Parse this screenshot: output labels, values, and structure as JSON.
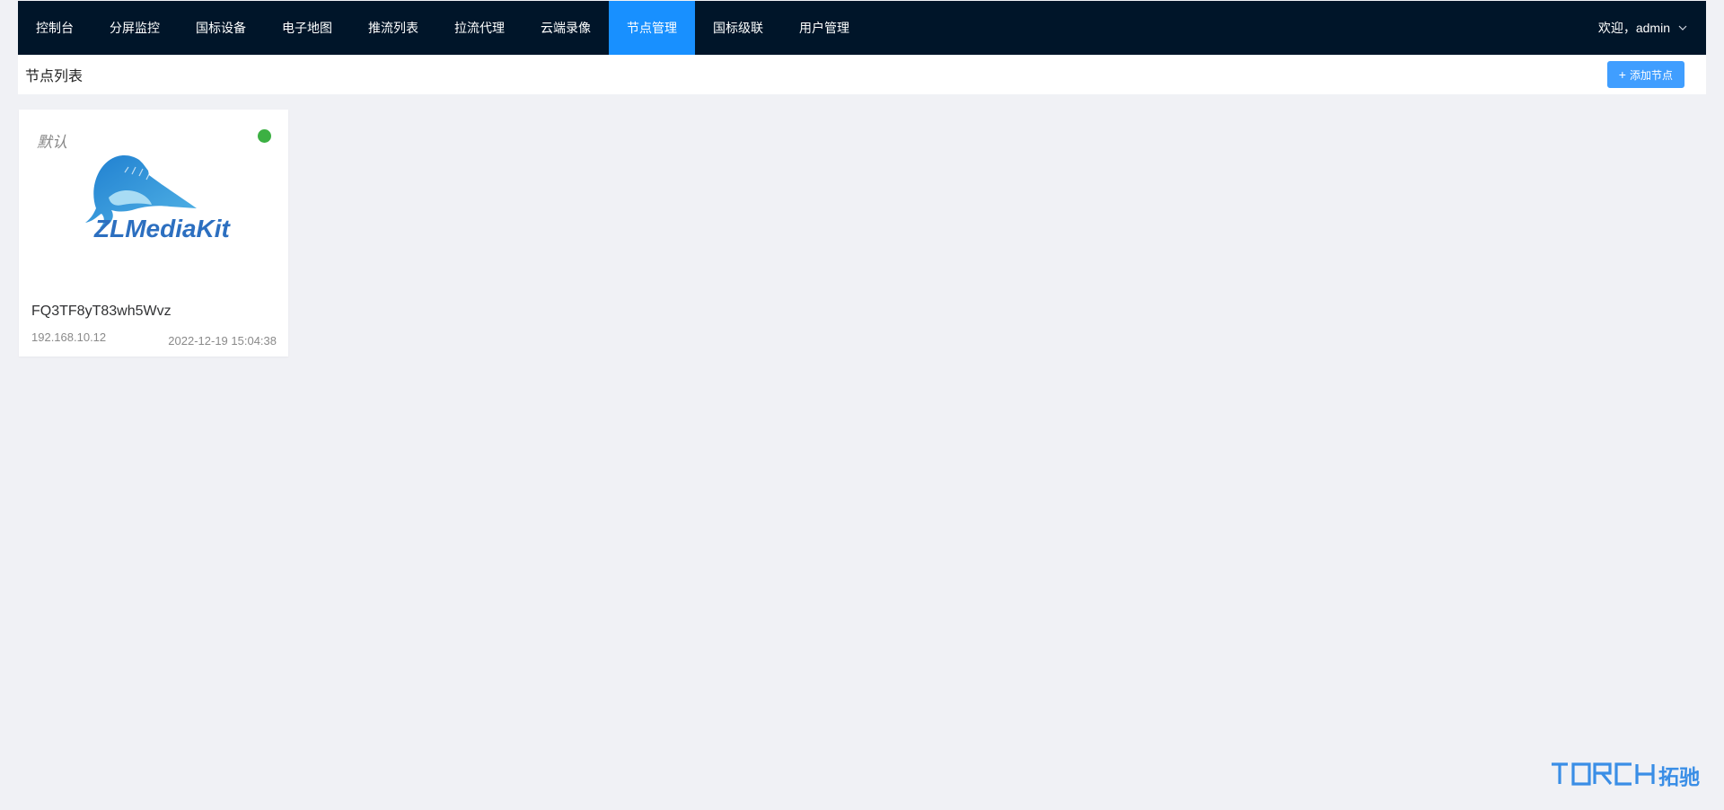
{
  "nav": {
    "items": [
      {
        "label": "控制台"
      },
      {
        "label": "分屏监控"
      },
      {
        "label": "国标设备"
      },
      {
        "label": "电子地图"
      },
      {
        "label": "推流列表"
      },
      {
        "label": "拉流代理"
      },
      {
        "label": "云端录像"
      },
      {
        "label": "节点管理",
        "active": true
      },
      {
        "label": "国标级联"
      },
      {
        "label": "用户管理"
      }
    ],
    "user_label": "欢迎，admin"
  },
  "header": {
    "title": "节点列表",
    "add_button_label": "添加节点",
    "add_button_icon": "plus-icon"
  },
  "nodes": [
    {
      "tag": "默认",
      "status": "online",
      "status_color": "#3cb043",
      "logo_text": "ZLMediaKit",
      "id": "FQ3TF8yT83wh5Wvz",
      "ip": "192.168.10.12",
      "time": "2022-12-19 15:04:38"
    }
  ],
  "watermark": {
    "text": "TORCH 拓驰"
  },
  "colors": {
    "nav_bg": "#001529",
    "nav_active": "#1890ff",
    "button": "#409eff",
    "page_bg": "#f0f1f5",
    "watermark": "#3a8ee6"
  }
}
